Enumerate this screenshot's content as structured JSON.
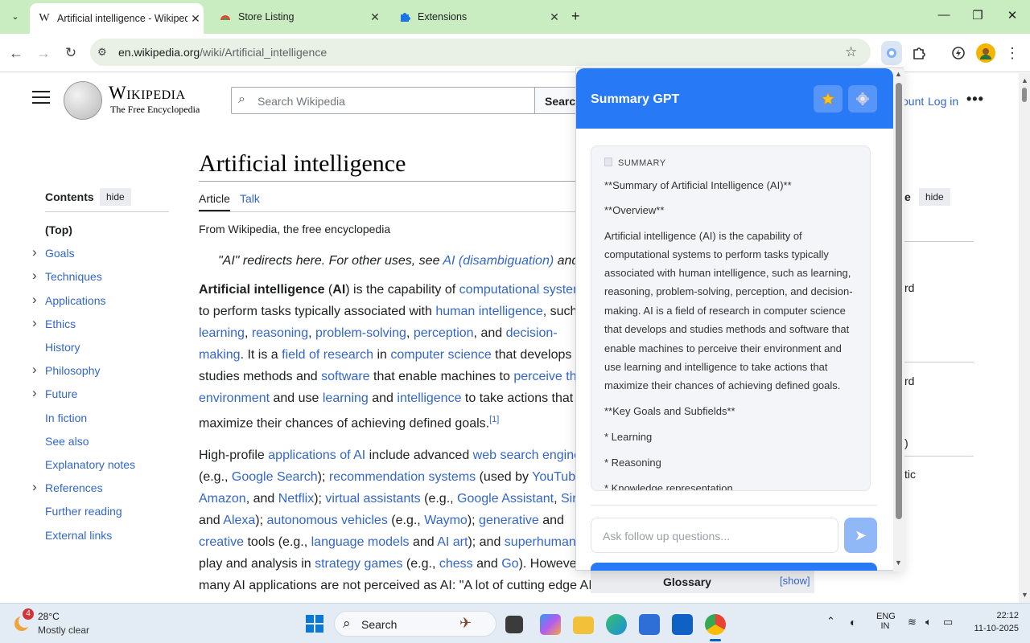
{
  "browser": {
    "tabs": [
      {
        "title": "Artificial intelligence - Wikipedia",
        "active": true
      },
      {
        "title": "Store Listing",
        "active": false
      },
      {
        "title": "Extensions",
        "active": false
      }
    ],
    "url_domain": "en.wikipedia.org",
    "url_path": "/wiki/Artificial_intelligence"
  },
  "wiki": {
    "logo_title": "Wikipedia",
    "logo_tagline": "The Free Encyclopedia",
    "search_placeholder": "Search Wikipedia",
    "search_button": "Search",
    "login": "Log in",
    "account_fragment": "ount",
    "toc_title": "Contents",
    "toc_hide": "hide",
    "toc": [
      {
        "label": "(Top)",
        "expand": false
      },
      {
        "label": "Goals",
        "expand": true
      },
      {
        "label": "Techniques",
        "expand": true
      },
      {
        "label": "Applications",
        "expand": true
      },
      {
        "label": "Ethics",
        "expand": true
      },
      {
        "label": "History",
        "expand": false
      },
      {
        "label": "Philosophy",
        "expand": true
      },
      {
        "label": "Future",
        "expand": true
      },
      {
        "label": "In fiction",
        "expand": false
      },
      {
        "label": "See also",
        "expand": false
      },
      {
        "label": "Explanatory notes",
        "expand": false
      },
      {
        "label": "References",
        "expand": true
      },
      {
        "label": "Further reading",
        "expand": false
      },
      {
        "label": "External links",
        "expand": false
      }
    ],
    "article_title": "Artificial intelligence",
    "tab_article": "Article",
    "tab_talk": "Talk",
    "from_line": "From Wikipedia, the free encyclopedia",
    "hatnote_pre": "\"AI\" redirects here. For other uses, see ",
    "hatnote_link": "AI (disambiguation)",
    "hatnote_post": " and Art",
    "right_hide": "hide",
    "right_frag_e": "e",
    "right_frag_rd1": "rd",
    "right_frag_rd2": "rd",
    "right_frag_paren": ")",
    "right_frag_tic": "tic",
    "glossary": "Glossary",
    "glossary_show": "[show]"
  },
  "summary_panel": {
    "title": "Summary GPT",
    "section_label": "SUMMARY",
    "lines": [
      "**Summary of Artificial Intelligence (AI)**",
      "**Overview**",
      "Artificial intelligence (AI) is the capability of",
      "computational systems to perform tasks typically",
      "associated with human intelligence, such as learning,",
      "reasoning, problem-solving, perception, and decision-",
      "making. AI is a field of research in computer science",
      "that develops and studies methods and software that",
      "enable machines to perceive their environment and",
      "use learning and intelligence to take actions that",
      "maximize their chances of achieving defined goals.",
      "**Key Goals and Subfields**",
      "* Learning",
      "* Reasoning",
      "* Knowledge representation"
    ],
    "ask_placeholder": "Ask follow up questions..."
  },
  "taskbar": {
    "weather_temp": "28°C",
    "weather_desc": "Mostly clear",
    "weather_badge": "4",
    "search_label": "Search",
    "lang_line1": "ENG",
    "lang_line2": "IN",
    "time": "22:12",
    "date": "11-10-2025"
  },
  "colors": {
    "accent": "#2879f6",
    "wiki_link": "#3366cc",
    "tab_strip": "#c9ecc1"
  }
}
